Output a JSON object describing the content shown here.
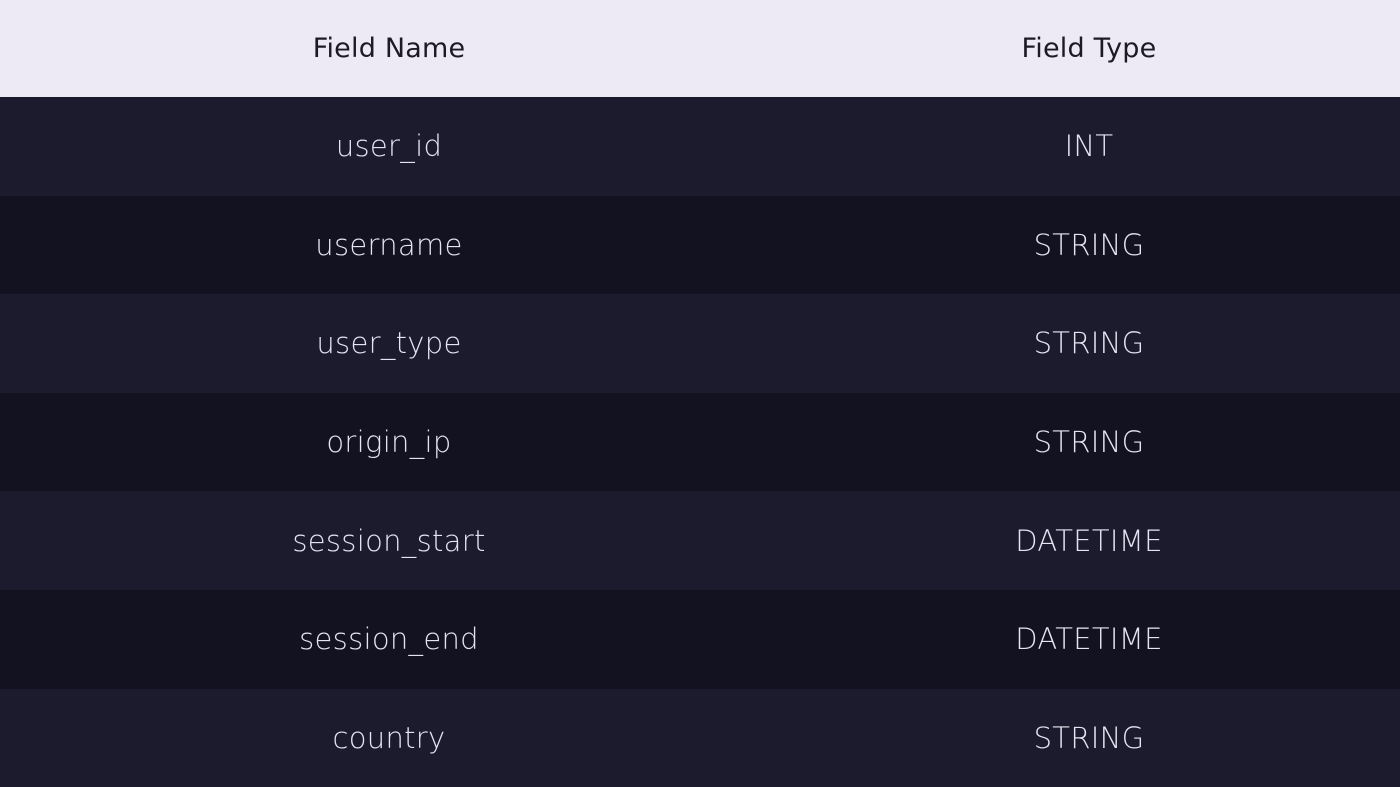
{
  "table": {
    "headers": {
      "field_name": "Field Name",
      "field_type": "Field Type"
    },
    "rows": [
      {
        "name": "user_id",
        "type": "INT"
      },
      {
        "name": "username",
        "type": "STRING"
      },
      {
        "name": "user_type",
        "type": "STRING"
      },
      {
        "name": "origin_ip",
        "type": "STRING"
      },
      {
        "name": "session_start",
        "type": "DATETIME"
      },
      {
        "name": "session_end",
        "type": "DATETIME"
      },
      {
        "name": "country",
        "type": "STRING"
      }
    ]
  },
  "colors": {
    "header_background": "#edeaf5",
    "row_background": "#1c1b2e",
    "row_alt_background": "#131220",
    "header_text": "#1b1a26",
    "body_text": "#e6e4f0"
  }
}
